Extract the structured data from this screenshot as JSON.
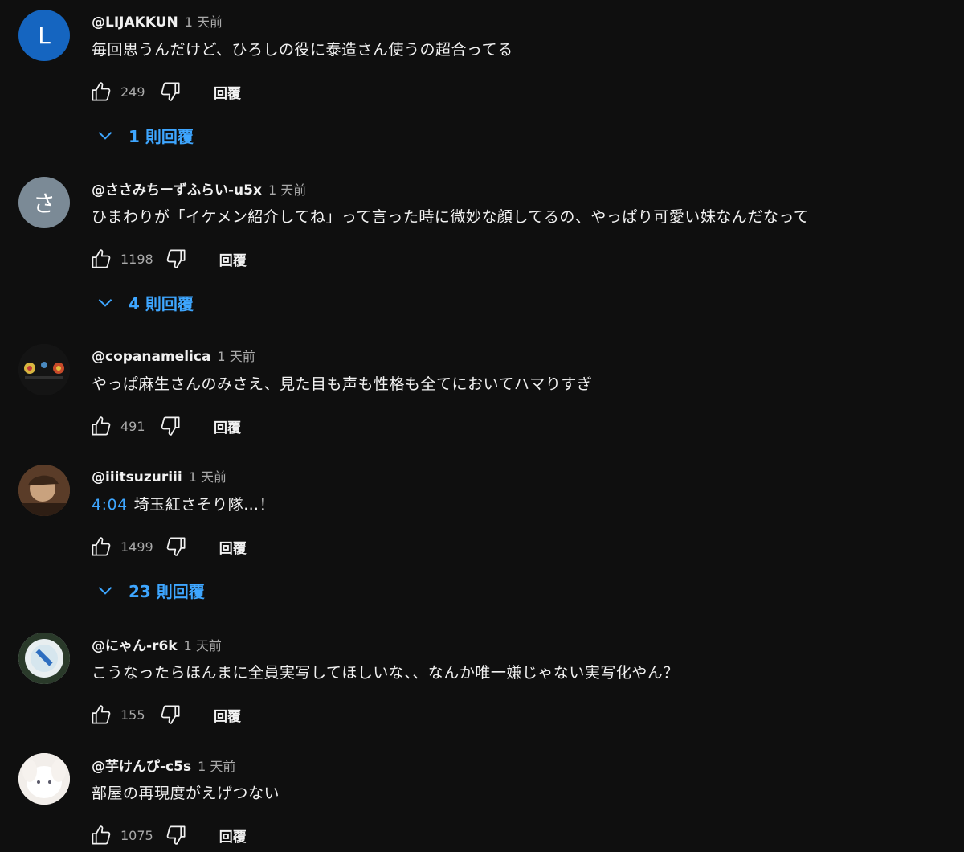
{
  "colors": {
    "background": "#0f0f0f",
    "text": "#f1f1f1",
    "secondary_text": "#aaaaaa",
    "link": "#3ea6ff"
  },
  "reply_label": "回覆",
  "icons": {
    "like": "thumbs-up-icon",
    "dislike": "thumbs-down-icon",
    "expand": "chevron-down-icon"
  },
  "comments": [
    {
      "avatar_letter": "L",
      "avatar_color": "#1565c0",
      "handle": "@LIJAKKUN",
      "time": "1 天前",
      "timestamp_link": "",
      "text": "毎回思うんだけど、ひろしの役に泰造さん使うの超合ってる",
      "likes": "249",
      "replies": "1 則回覆"
    },
    {
      "avatar_letter": "さ",
      "avatar_color": "#7b8a96",
      "handle": "@ささみちーずふらい-u5x",
      "time": "1 天前",
      "timestamp_link": "",
      "text": "ひまわりが「イケメン紹介してね」って言った時に微妙な顔してるの、やっぱり可愛い妹なんだなって",
      "likes": "1198",
      "replies": "4 則回覆"
    },
    {
      "avatar_letter": "",
      "avatar_color": "#1a1a1a",
      "handle": "@copanamelica",
      "time": "1 天前",
      "timestamp_link": "",
      "text": "やっぱ麻生さんのみさえ、見た目も声も性格も全てにおいてハマりすぎ",
      "likes": "491",
      "replies": ""
    },
    {
      "avatar_letter": "",
      "avatar_color": "#6b4a33",
      "handle": "@iiitsuzuriii",
      "time": "1 天前",
      "timestamp_link": "4:04",
      "text": "埼玉紅さそり隊…！",
      "likes": "1499",
      "replies": "23 則回覆"
    },
    {
      "avatar_letter": "",
      "avatar_color": "#cfd8dc",
      "handle": "@にゃん-r6k",
      "time": "1 天前",
      "timestamp_link": "",
      "text": "こうなったらほんまに全員実写してほしいな、、なんか唯一嫌じゃない実写化やん？",
      "likes": "155",
      "replies": ""
    },
    {
      "avatar_letter": "",
      "avatar_color": "#e8e4e0",
      "handle": "@芋けんぴ-c5s",
      "time": "1 天前",
      "timestamp_link": "",
      "text": "部屋の再現度がえげつない",
      "likes": "1075",
      "replies": ""
    }
  ]
}
